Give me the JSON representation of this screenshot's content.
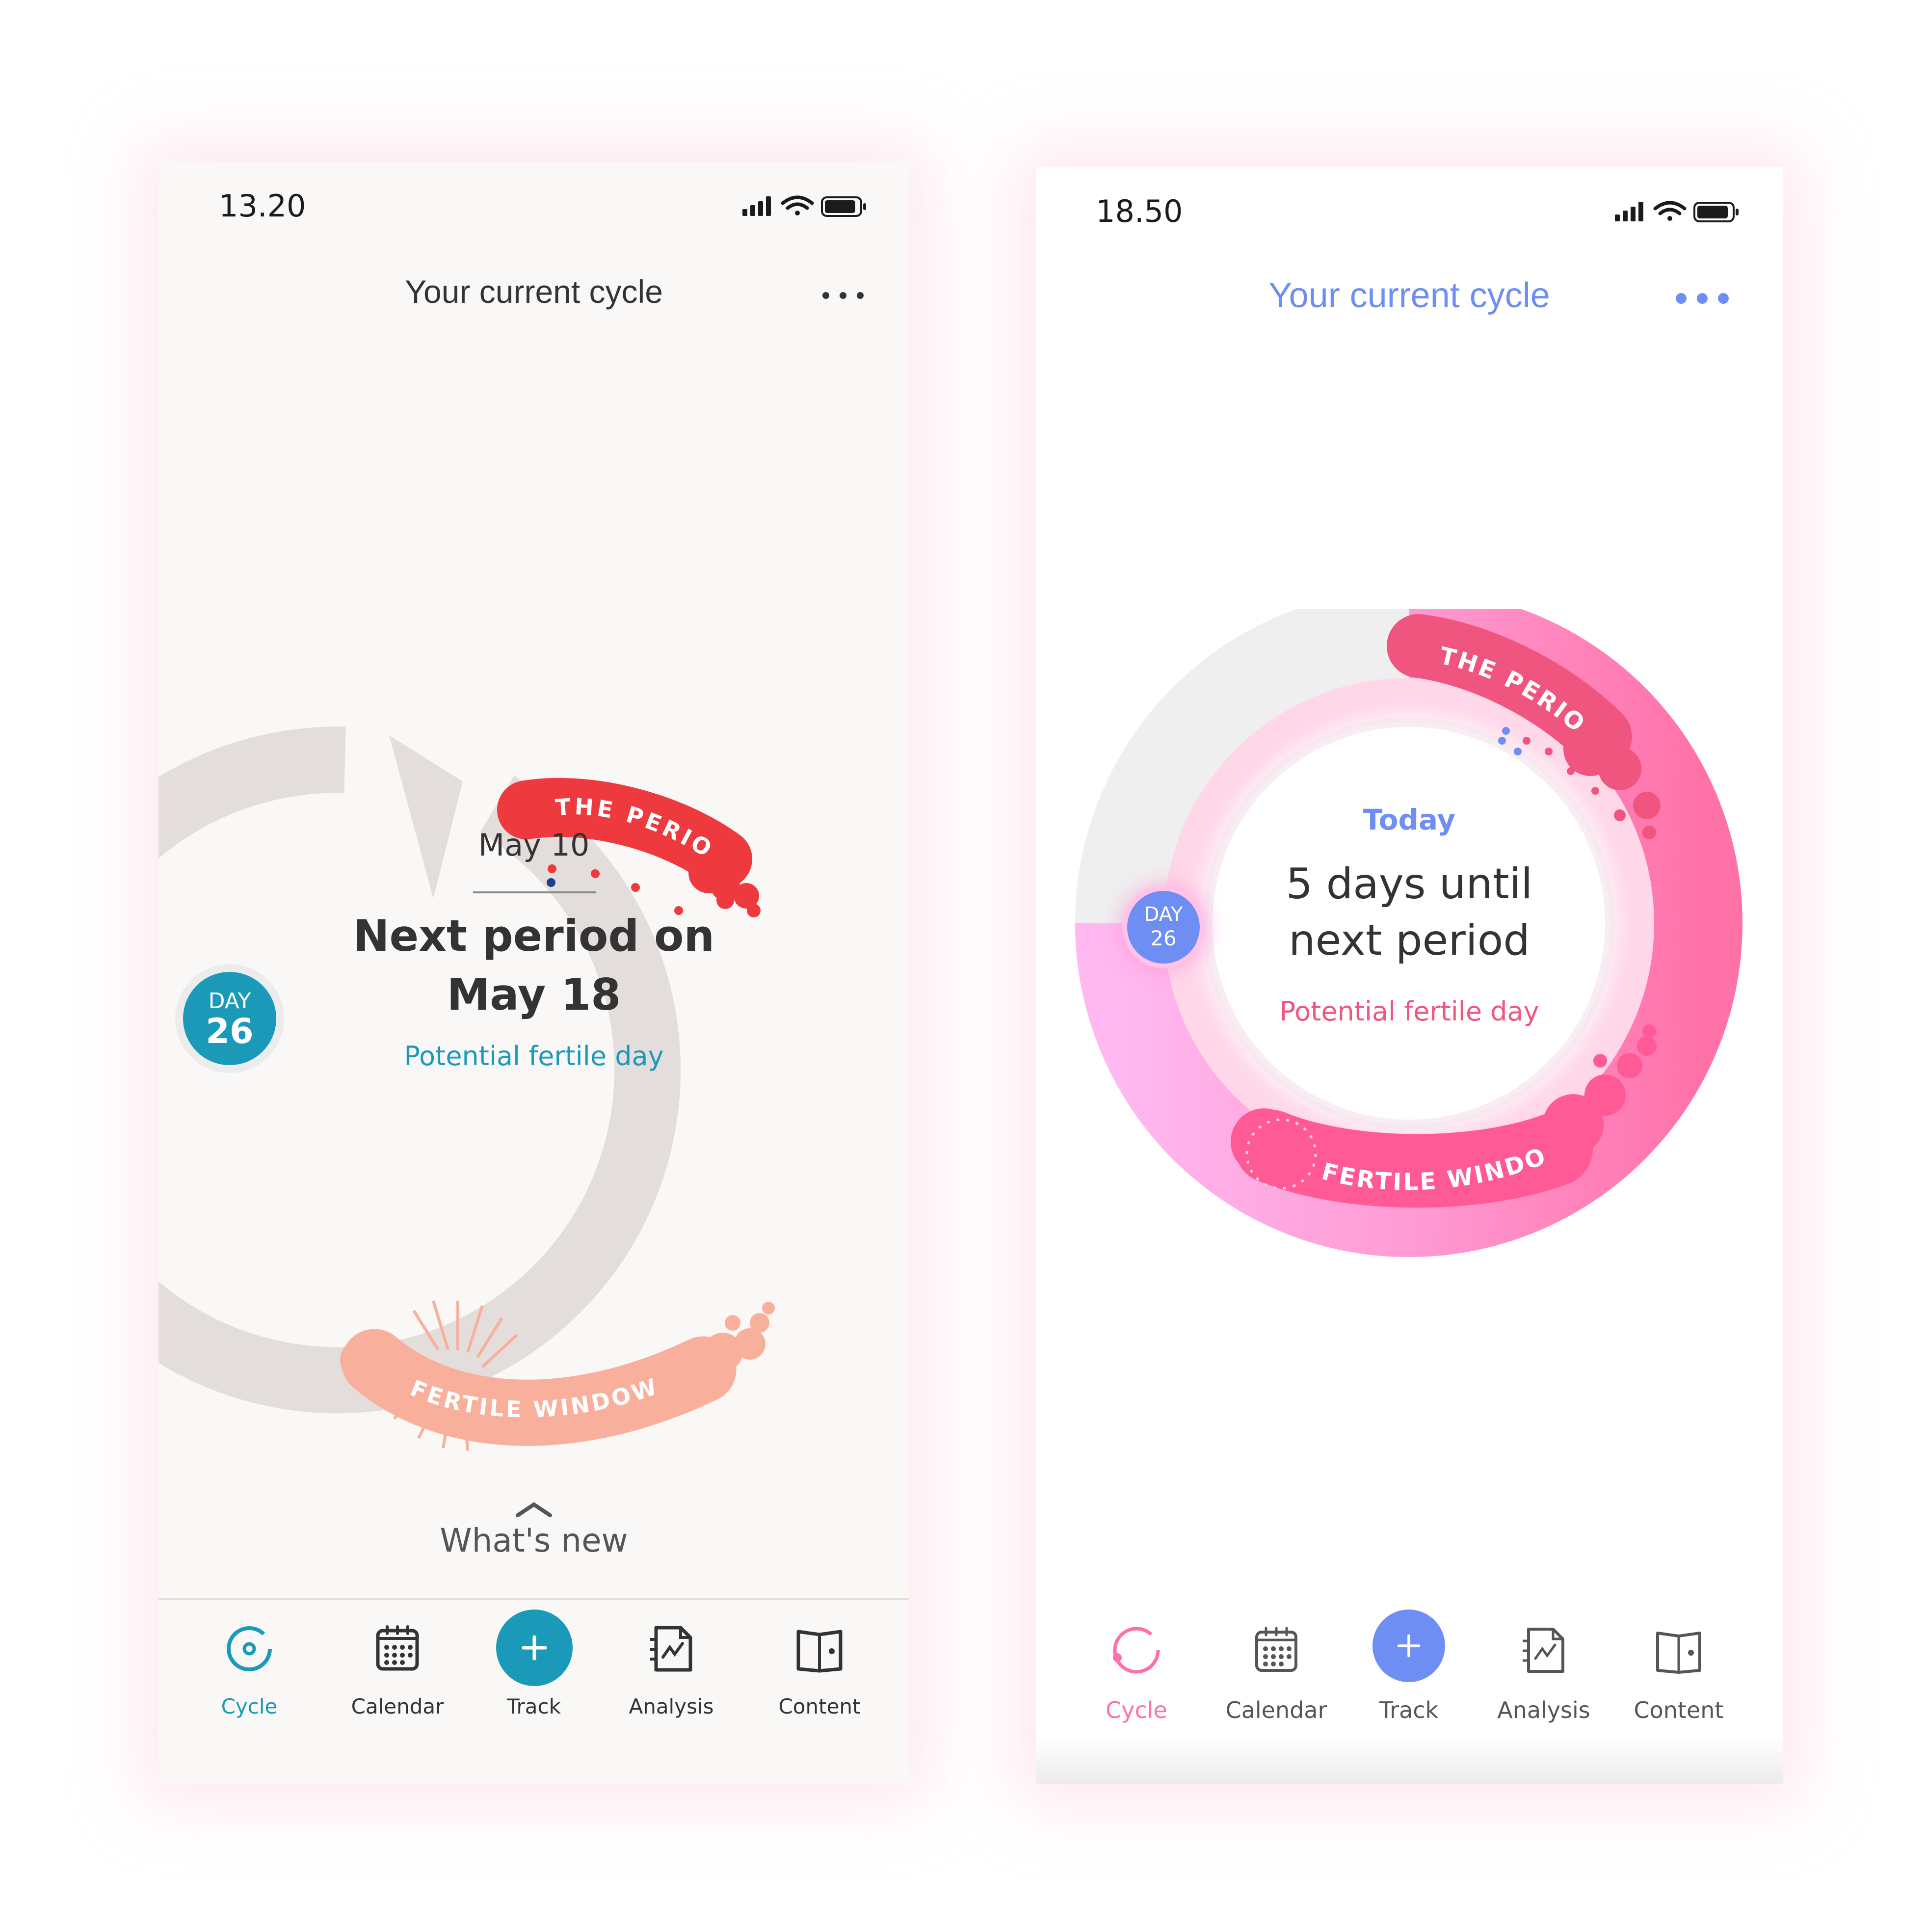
{
  "screen_a": {
    "status_time": "13.20",
    "header_title": "Your current cycle",
    "ring": {
      "period_label": "THE PERIOD",
      "fertile_label": "FERTILE WINDOW"
    },
    "center": {
      "date": "May 10",
      "headline_line1": "Next period on",
      "headline_line2": "May 18",
      "subline": "Potential fertile day"
    },
    "day_badge": {
      "label": "DAY",
      "number": "26"
    },
    "whats_new": "What's new",
    "tabs": [
      {
        "label": "Cycle",
        "icon": "cycle-icon",
        "active": true
      },
      {
        "label": "Calendar",
        "icon": "calendar-icon"
      },
      {
        "label": "Track",
        "icon": "plus-icon"
      },
      {
        "label": "Analysis",
        "icon": "analysis-icon"
      },
      {
        "label": "Content",
        "icon": "book-icon"
      }
    ],
    "colors": {
      "accent": "#1a9ab8",
      "period": "#ee3a3e",
      "fertile": "#f8b09c",
      "ring": "#e3dedb"
    }
  },
  "screen_b": {
    "status_time": "18.50",
    "header_title": "Your current cycle",
    "ring": {
      "period_label": "THE PERIOD",
      "fertile_label": "FERTILE WINDOW"
    },
    "center": {
      "kicker": "Today",
      "headline_line1": "5 days until",
      "headline_line2": "next period",
      "subline": "Potential fertile day"
    },
    "day_badge": {
      "label": "DAY",
      "number": "26"
    },
    "tabs": [
      {
        "label": "Cycle",
        "icon": "cycle-icon",
        "active": true
      },
      {
        "label": "Calendar",
        "icon": "calendar-icon"
      },
      {
        "label": "Track",
        "icon": "plus-icon"
      },
      {
        "label": "Analysis",
        "icon": "analysis-icon"
      },
      {
        "label": "Content",
        "icon": "book-icon"
      }
    ],
    "colors": {
      "accent": "#6f8ef4",
      "period": "#f0557f",
      "fertile": "#ff6fa8",
      "ring_light": "#ffb8f0"
    }
  }
}
